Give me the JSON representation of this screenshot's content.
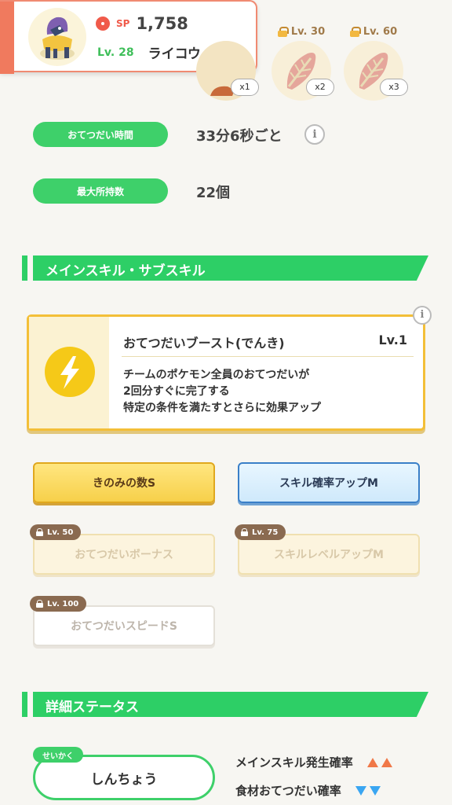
{
  "header": {
    "sp_label": "SP",
    "sp_value": "1,758",
    "level": "Lv. 28",
    "name": "ライコウ"
  },
  "ingredients": [
    {
      "lock": "",
      "count": "x1"
    },
    {
      "lock": "Lv. 30",
      "count": "x2"
    },
    {
      "lock": "Lv. 60",
      "count": "x3"
    }
  ],
  "stats": {
    "help_time_label": "おてつだい時間",
    "help_time_value": "33分6秒ごと",
    "max_carry_label": "最大所持数",
    "max_carry_value": "22個"
  },
  "skills_section": {
    "title": "メインスキル・サブスキル"
  },
  "main_skill": {
    "name": "おてつだいブースト(でんき)",
    "level": "Lv.1",
    "desc_line1": "チームのポケモン全員のおてつだいが",
    "desc_line2": "2回分すぐに完了する",
    "desc_line3": "特定の条件を満たすとさらに効果アップ"
  },
  "sub_skills": [
    {
      "label": "きのみの数S",
      "lock": ""
    },
    {
      "label": "スキル確率アップM",
      "lock": ""
    },
    {
      "label": "おてつだいボーナス",
      "lock": "Lv. 50"
    },
    {
      "label": "スキルレベルアップM",
      "lock": "Lv. 75"
    },
    {
      "label": "おてつだいスピードS",
      "lock": "Lv. 100"
    }
  ],
  "details_section": {
    "title": "詳細ステータス"
  },
  "nature": {
    "tag": "せいかく",
    "value": "しんちょう",
    "up_label": "メインスキル発生確率",
    "down_label": "食材おてつだい確率"
  },
  "colors": {
    "accent_green": "#3ed06a",
    "header_accent": "#f07a5e",
    "up_arrow": "#f07848",
    "down_arrow": "#3aa6f2"
  },
  "icons": [
    "pokeball-icon",
    "lock-icon",
    "info-icon",
    "lightning-bolt-icon",
    "ingredient-leaf-icon"
  ]
}
